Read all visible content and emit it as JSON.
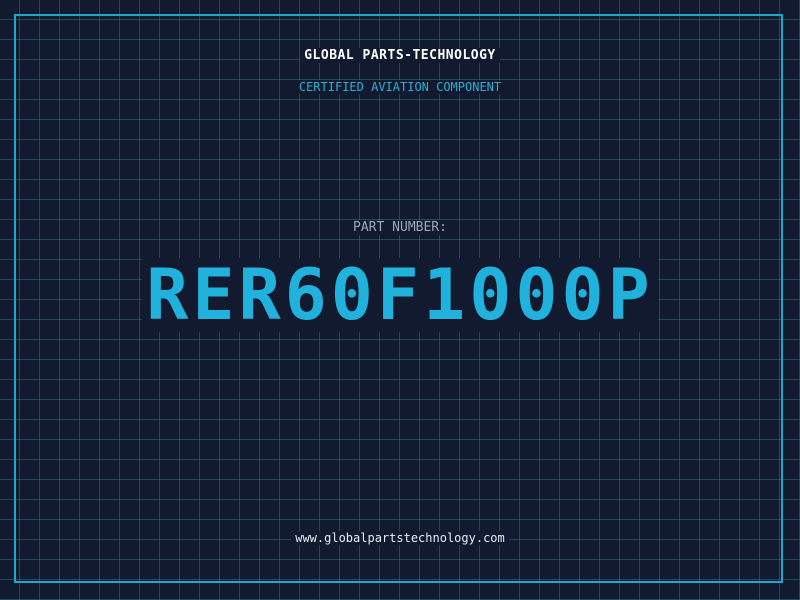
{
  "header": {
    "company": "GLOBAL PARTS-TECHNOLOGY",
    "tagline": "CERTIFIED AVIATION COMPONENT"
  },
  "part": {
    "label": "PART NUMBER:",
    "number": "RER60F1000P"
  },
  "footer": {
    "url": "www.globalpartstechnology.com"
  },
  "colors": {
    "background": "#111a2e",
    "grid": "#286e8c",
    "accent": "#20b2dc",
    "frame": "#1ea6cf"
  }
}
